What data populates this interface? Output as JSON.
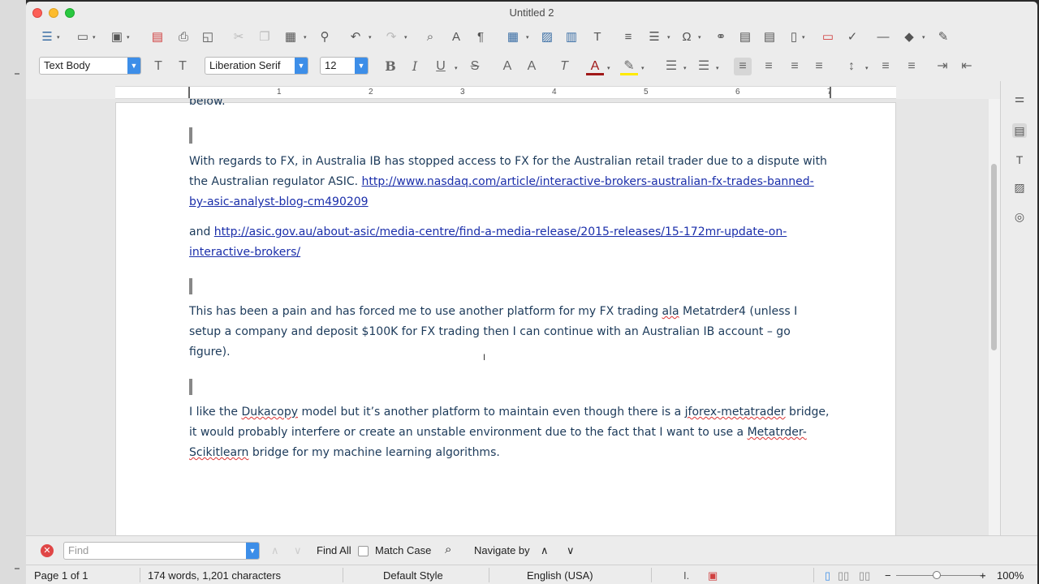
{
  "window": {
    "title": "Untitled 2"
  },
  "toolbar2": {
    "paragraph_style": "Text Body",
    "font_name": "Liberation Serif",
    "font_size": "12"
  },
  "ruler": {
    "numbers": [
      "1",
      "2",
      "3",
      "4",
      "5",
      "6",
      "7"
    ]
  },
  "document": {
    "para0_tail": "below.",
    "para1_text": "With regards to FX, in Australia IB has stopped access to FX for the Australian retail trader due to a dispute with the Australian regulator ASIC. ",
    "para1_link": "http://www.nasdaq.com/article/interactive-brokers-australian-fx-trades-banned-by-asic-analyst-blog-cm490209",
    "para2_text": "and ",
    "para2_link": "http://asic.gov.au/about-asic/media-centre/find-a-media-release/2015-releases/15-172mr-update-on-interactive-brokers/",
    "para3_a": "This has been a pain and has forced me to use another platform for my FX trading ",
    "para3_ala": "ala",
    "para3_b": " Metatrder4 (unless I setup a company and deposit $100K for FX trading then I can continue with an Australian IB account – go figure).",
    "para4_a": "I like the ",
    "para4_duka": "Dukacopy",
    "para4_b": " model but it’s another platform to maintain even though there is a ",
    "para4_bridge": "jforex-metatrader",
    "para4_c": " bridge, it would probably interfere or create an unstable environment due to the fact that I want to use a ",
    "para4_meta": "Metatrder-Scikitlearn",
    "para4_d": " bridge for my machine learning algorithms."
  },
  "findbar": {
    "placeholder": "Find",
    "find_all": "Find All",
    "match_case": "Match Case",
    "navigate_by": "Navigate by"
  },
  "statusbar": {
    "page": "Page 1 of 1",
    "word_count": "174 words, 1,201 characters",
    "page_style": "Default Style",
    "language": "English (USA)",
    "zoom": "100%"
  },
  "colors": {
    "accent": "#3d8ee8",
    "body_text": "#1c3a5a",
    "link": "#1a2eaa",
    "close": "#fc5f57",
    "minimize": "#fdbc2e",
    "maximize": "#29c840"
  }
}
